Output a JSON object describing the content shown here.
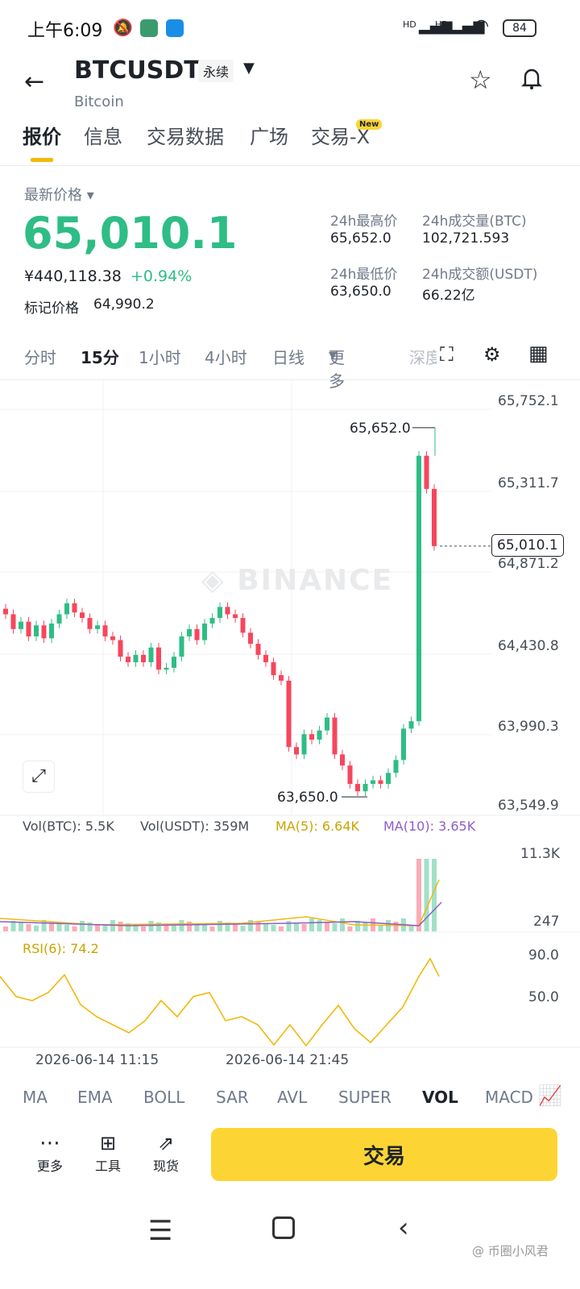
{
  "status": {
    "time": "上午6:09",
    "battery": "84",
    "net1": "HD",
    "net2": "HD"
  },
  "header": {
    "symbol": "BTCUSDT",
    "contract": "永续",
    "subtitle": "Bitcoin"
  },
  "tabs": [
    "报价",
    "信息",
    "交易数据",
    "广场",
    "交易-X"
  ],
  "tab_badge": "New",
  "price": {
    "label": "最新价格",
    "last": "65,010.1",
    "cny": "¥440,118.38",
    "change": "+0.94%",
    "mark_label": "标记价格",
    "mark": "64,990.2",
    "high_label": "24h最高价",
    "high": "65,652.0",
    "vol_btc_label": "24h成交量(BTC)",
    "vol_btc": "102,721.593",
    "low_label": "24h最低价",
    "low": "63,650.0",
    "vol_usdt_label": "24h成交额(USDT)",
    "vol_usdt": "66.22亿"
  },
  "timeframes": [
    "分时",
    "15分",
    "1小时",
    "4小时",
    "日线",
    "更多",
    "深度"
  ],
  "chart": {
    "price_axis": [
      "65,752.1",
      "65,311.7",
      "64,871.2",
      "64,430.8",
      "63,990.3",
      "63,549.9"
    ],
    "current_price": "65,010.1",
    "high_marker": "65,652.0",
    "low_marker": "63,650.0",
    "watermark": "BINANCE",
    "vol_legend": {
      "btc": "Vol(BTC): 5.5K",
      "usdt": "Vol(USDT): 359M",
      "ma5": "MA(5): 6.64K",
      "ma10": "MA(10): 3.65K"
    },
    "vol_axis": [
      "11.3K",
      "247"
    ],
    "rsi_legend": "RSI(6): 74.2",
    "rsi_axis": [
      "90.0",
      "50.0"
    ],
    "time_axis": [
      "2026-06-14 11:15",
      "2026-06-14 21:45"
    ],
    "colors": {
      "up": "#2ebd85",
      "down": "#f6465d",
      "ma5": "#f0b90b",
      "ma10": "#8e5dc9"
    }
  },
  "chart_data": {
    "type": "candlestick",
    "closes": [
      64640,
      64560,
      64600,
      64520,
      64580,
      64510,
      64590,
      64640,
      64700,
      64650,
      64620,
      64560,
      64580,
      64520,
      64500,
      64410,
      64380,
      64420,
      64380,
      64460,
      64340,
      64350,
      64410,
      64520,
      64560,
      64500,
      64590,
      64620,
      64680,
      64640,
      64620,
      64540,
      64480,
      64420,
      64380,
      64310,
      64280,
      63920,
      63880,
      63990,
      63960,
      64010,
      64080,
      63880,
      63820,
      63720,
      63680,
      63720,
      63740,
      63720,
      63780,
      63850,
      64020,
      64060,
      65500,
      65320,
      65010
    ],
    "vol_ma5_label": "MA(5)",
    "vol_ma10_label": "MA(10)"
  },
  "indicators": [
    "MA",
    "EMA",
    "BOLL",
    "SAR",
    "AVL",
    "SUPER",
    "VOL",
    "MACD"
  ],
  "bottom": {
    "more": "更多",
    "tools": "工具",
    "spot": "现货",
    "trade": "交易"
  },
  "watermark_credit": "@ 币圈小风君"
}
